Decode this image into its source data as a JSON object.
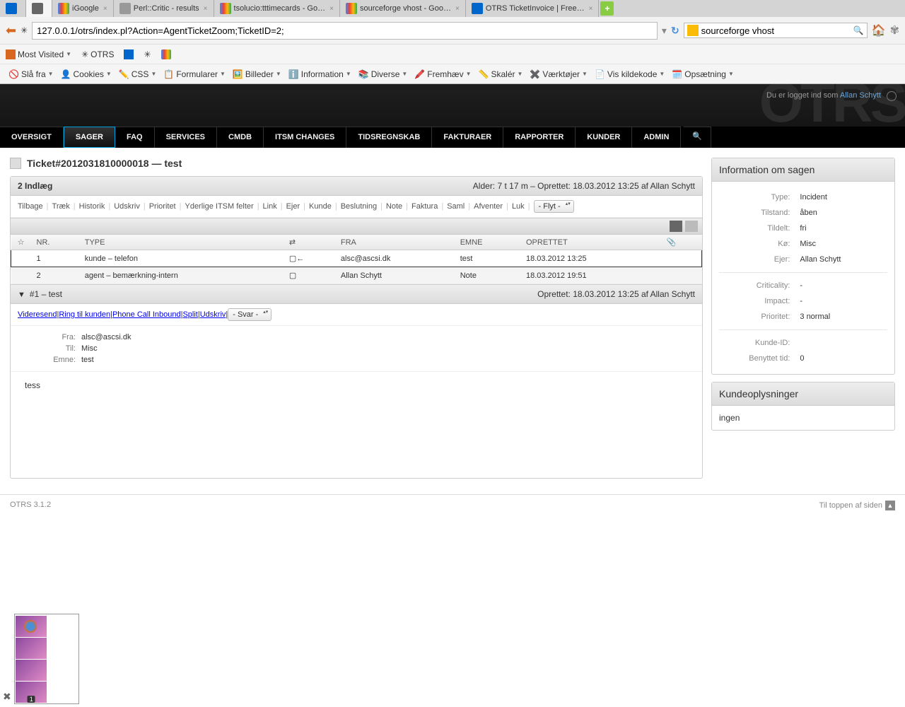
{
  "browser": {
    "tabs": [
      {
        "label": "",
        "icon": "sf"
      },
      {
        "label": "",
        "icon": "otrs"
      },
      {
        "label": "iGoogle",
        "icon": "google"
      },
      {
        "label": "Perl::Critic - results",
        "icon": "doc"
      },
      {
        "label": "tsolucio:tttimecards - Go…",
        "icon": "google"
      },
      {
        "label": "sourceforge vhost - Goo…",
        "icon": "google"
      },
      {
        "label": "OTRS TicketInvoice | Free…",
        "icon": "sf"
      }
    ],
    "url": "127.0.0.1/otrs/index.pl?Action=AgentTicketZoom;TicketID=2;",
    "search": "sourceforge vhost",
    "bookmarks": [
      "Most Visited",
      "OTRS"
    ],
    "devbar": [
      {
        "label": "Slå fra",
        "ico": "🚫"
      },
      {
        "label": "Cookies",
        "ico": "👤"
      },
      {
        "label": "CSS",
        "ico": "✏️"
      },
      {
        "label": "Formularer",
        "ico": "📋"
      },
      {
        "label": "Billeder",
        "ico": "🖼️"
      },
      {
        "label": "Information",
        "ico": "ℹ️"
      },
      {
        "label": "Diverse",
        "ico": "📚"
      },
      {
        "label": "Fremhæv",
        "ico": "🖍️"
      },
      {
        "label": "Skalér",
        "ico": "📏"
      },
      {
        "label": "Værktøjer",
        "ico": "✖️"
      },
      {
        "label": "Vis kildekode",
        "ico": "📄"
      },
      {
        "label": "Opsætning",
        "ico": "🗓️"
      }
    ]
  },
  "header": {
    "login_prefix": "Du er logget ind som ",
    "login_user": "Allan Schytt"
  },
  "nav": [
    "OVERSIGT",
    "SAGER",
    "FAQ",
    "SERVICES",
    "CMDB",
    "ITSM CHANGES",
    "TIDSREGNSKAB",
    "FAKTURAER",
    "RAPPORTER",
    "KUNDER",
    "ADMIN"
  ],
  "nav_active": "SAGER",
  "ticket": {
    "title": "Ticket#2012031810000018 — test",
    "indlaeg": "2 Indlæg",
    "meta": "Alder: 7 t 17 m – Oprettet: 18.03.2012 13:25 af Allan Schytt",
    "actions": [
      "Tilbage",
      "Træk",
      "Historik",
      "Udskriv",
      "Prioritet",
      "Yderlige ITSM felter",
      "Link",
      "Ejer",
      "Kunde",
      "Beslutning",
      "Note",
      "Faktura",
      "Saml",
      "Afventer",
      "Luk"
    ],
    "move_select": "- Flyt -"
  },
  "table": {
    "headers": {
      "nr": "NR.",
      "type": "TYPE",
      "dir": "⇄",
      "fra": "FRA",
      "emne": "EMNE",
      "oprettet": "OPRETTET",
      "att": "📎"
    },
    "rows": [
      {
        "nr": "1",
        "type": "kunde – telefon",
        "dir": "▢←",
        "fra": "alsc@ascsi.dk",
        "emne": "test",
        "oprettet": "18.03.2012 13:25",
        "selected": true
      },
      {
        "nr": "2",
        "type": "agent – bemærkning-intern",
        "dir": "▢",
        "fra": "Allan Schytt",
        "emne": "Note",
        "oprettet": "18.03.2012 19:51",
        "selected": false
      }
    ]
  },
  "article": {
    "header_left": "#1 – test",
    "header_right": "Oprettet: 18.03.2012 13:25 af Allan Schytt",
    "actions": [
      "Videresend",
      "Ring til kunden",
      "Phone Call Inbound",
      "Split",
      "Udskriv"
    ],
    "svar_select": "- Svar -",
    "meta": {
      "fra_lbl": "Fra:",
      "fra_val": "alsc@ascsi.dk",
      "til_lbl": "Til:",
      "til_val": "Misc",
      "emne_lbl": "Emne:",
      "emne_val": "test"
    },
    "body": "tess"
  },
  "info": {
    "title": "Information om sagen",
    "rows1": [
      {
        "lbl": "Type:",
        "val": "Incident"
      },
      {
        "lbl": "Tilstand:",
        "val": "åben"
      },
      {
        "lbl": "Tildelt:",
        "val": "fri"
      },
      {
        "lbl": "Kø:",
        "val": "Misc"
      },
      {
        "lbl": "Ejer:",
        "val": "Allan Schytt"
      }
    ],
    "rows2": [
      {
        "lbl": "Criticality:",
        "val": "-"
      },
      {
        "lbl": "Impact:",
        "val": "-"
      },
      {
        "lbl": "Prioritet:",
        "val": "3 normal"
      }
    ],
    "rows3": [
      {
        "lbl": "Kunde-ID:",
        "val": ""
      },
      {
        "lbl": "Benyttet tid:",
        "val": "0"
      }
    ]
  },
  "customer": {
    "title": "Kundeoplysninger",
    "body": "ingen"
  },
  "footer": {
    "version": "OTRS 3.1.2",
    "top": "Til toppen af siden"
  },
  "dock_badge": "1"
}
